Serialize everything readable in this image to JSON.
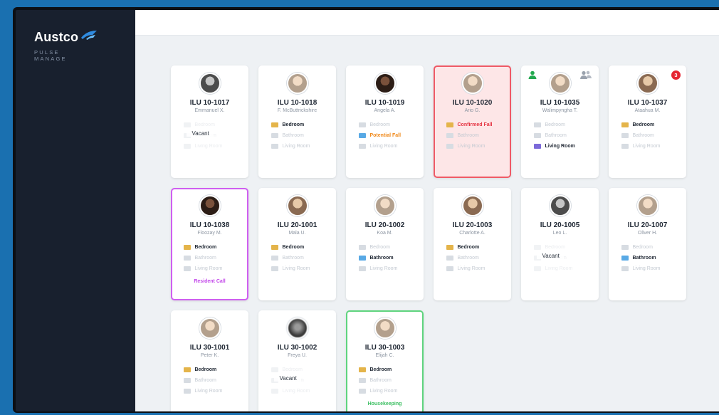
{
  "brand": {
    "name": "Austco",
    "sub_line1": "PULSE",
    "sub_line2": "MANAGE"
  },
  "colors": {
    "fall": "#ef5a66",
    "resident_call": "#cf5ff0",
    "housekeeping": "#5fd47e",
    "potential_fall": "#f08a1c",
    "staff_present": "#23a94f",
    "badge": "#e52531"
  },
  "location_labels": {
    "bedroom": "Bedroom",
    "bathroom": "Bathroom",
    "living": "Living Room"
  },
  "rooms": [
    {
      "id": "ILU 10-1017",
      "resident": "Emmanuel X.",
      "vacant": "Vacant"
    },
    {
      "id": "ILU 10-1018",
      "resident": "F. McButtrickshire"
    },
    {
      "id": "ILU 10-1019",
      "resident": "Angela A.",
      "alert": "Potential Fall"
    },
    {
      "id": "ILU 10-1020",
      "resident": "Ario G.",
      "alert": "Confirmed Fall"
    },
    {
      "id": "ILU 10-1035",
      "resident": "Walimpyngha T."
    },
    {
      "id": "ILU 10-1037",
      "resident": "Ataahua M.",
      "badge": "3"
    },
    {
      "id": "ILU 10-1038",
      "resident": "Floozay M.",
      "status": "Resident Call"
    },
    {
      "id": "ILU 20-1001",
      "resident": "Mala U."
    },
    {
      "id": "ILU 20-1002",
      "resident": "Koa M."
    },
    {
      "id": "ILU 20-1003",
      "resident": "Charlotte A."
    },
    {
      "id": "ILU 20-1005",
      "resident": "Leo L.",
      "vacant": "Vacant"
    },
    {
      "id": "ILU 20-1007",
      "resident": "Oliver H."
    },
    {
      "id": "ILU 30-1001",
      "resident": "Peter K."
    },
    {
      "id": "ILU 30-1002",
      "resident": "Freya U.",
      "vacant": "Vacant"
    },
    {
      "id": "ILU 30-1003",
      "resident": "Elijah C.",
      "status": "Housekeeping"
    }
  ]
}
